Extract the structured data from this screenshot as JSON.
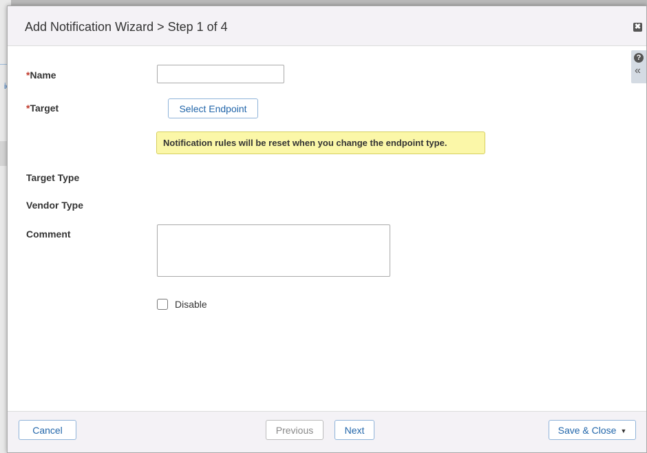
{
  "background": {
    "fragment_text": "ic"
  },
  "dialog": {
    "title": "Add Notification Wizard > Step 1 of 4",
    "close_icon": "✖",
    "help_icon": "?",
    "collapse_icon": "«"
  },
  "form": {
    "required_marker": "*",
    "name_label": "Name",
    "name_value": "",
    "target_label": "Target",
    "select_endpoint_label": "Select Endpoint",
    "warning_text": "Notification rules will be reset when you change the endpoint type.",
    "target_type_label": "Target Type",
    "vendor_type_label": "Vendor Type",
    "comment_label": "Comment",
    "comment_value": "",
    "disable_label": "Disable",
    "disable_checked": false
  },
  "footer": {
    "cancel_label": "Cancel",
    "previous_label": "Previous",
    "next_label": "Next",
    "save_close_label": "Save & Close",
    "save_caret": "▼"
  },
  "colors": {
    "accent": "#2266aa",
    "header_bg": "#f4f2f6",
    "warning_bg": "#fbf7a8",
    "required": "#c0392b"
  }
}
